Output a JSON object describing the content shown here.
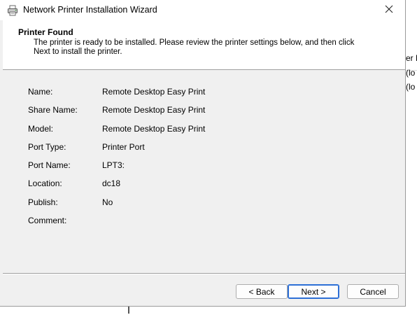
{
  "window": {
    "title": "Network Printer Installation Wizard"
  },
  "header": {
    "title": "Printer Found",
    "description": "The printer is ready to be installed. Please review the printer settings below, and then click Next to install the printer."
  },
  "details": [
    {
      "label": "Name:",
      "value": "Remote Desktop Easy Print"
    },
    {
      "label": "Share Name:",
      "value": "Remote Desktop Easy Print"
    },
    {
      "label": "Model:",
      "value": "Remote Desktop Easy Print"
    },
    {
      "label": "Port Type:",
      "value": "Printer Port"
    },
    {
      "label": "Port Name:",
      "value": "LPT3:"
    },
    {
      "label": "Location:",
      "value": "dc18"
    },
    {
      "label": "Publish:",
      "value": "No"
    },
    {
      "label": "Comment:",
      "value": ""
    }
  ],
  "buttons": {
    "back": "< Back",
    "next": "Next >",
    "cancel": "Cancel"
  },
  "background": {
    "right_fragments": [
      "er N",
      "(lo",
      "(lo"
    ]
  },
  "colors": {
    "dialog_bg": "#f0f0f0",
    "default_button_border": "#2d6fd6"
  },
  "icons": {
    "title": "printer-icon",
    "close": "close-icon"
  }
}
